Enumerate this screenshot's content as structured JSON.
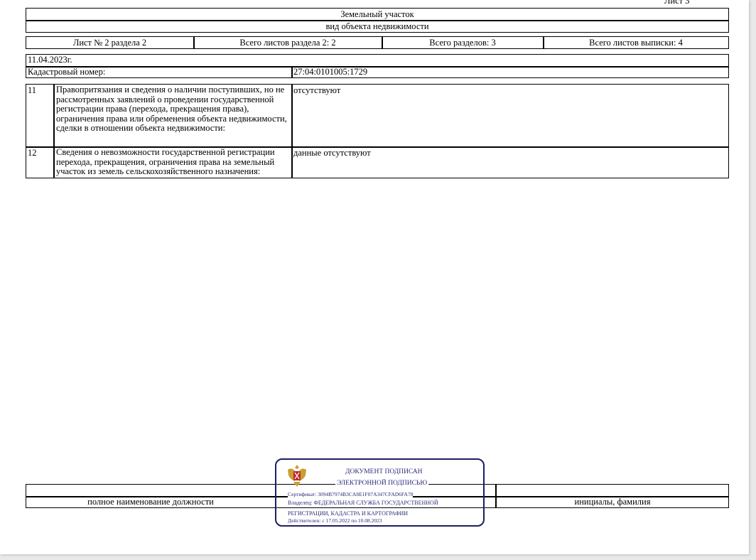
{
  "sheet_label": "Лист 3",
  "header": {
    "object_type": "Земельный участок",
    "object_type_caption": "вид объекта недвижимости"
  },
  "sheet_info": [
    "Лист № 2 раздела 2",
    "Всего листов раздела 2: 2",
    "Всего разделов: 3",
    "Всего листов выписки: 4"
  ],
  "date": "11.04.2023г.",
  "cadastral": {
    "label": "Кадастровый номер:",
    "value": "27:04:0101005:1729"
  },
  "rows": [
    {
      "num": "11",
      "label": "Правопритязания и сведения о наличии поступивших, но не рассмотренных заявлений о проведении государственной регистрации права (перехода, прекращения права), ограничения права или обременения объекта недвижимости, сделки в отношении объекта недвижимости:",
      "value": "отсутствуют"
    },
    {
      "num": "12",
      "label": "Сведения о невозможности государственной регистрации перехода, прекращения, ограничения права на земельный участок из земель сельскохозяйственного назначения:",
      "value": "данные отсутствуют"
    }
  ],
  "footer": {
    "position_caption": "полное наименование должности",
    "name_caption": "инициалы, фамилия"
  },
  "stamp": {
    "line1": "ДОКУМЕНТ ПОДПИСАН",
    "line2": "ЭЛЕКТРОННОЙ ПОДПИСЬЮ",
    "certificate": "Сертификат: 3094B7974B3CA8E1F07A347CFAD6FA78",
    "owner1": "Владелец: ФЕДЕРАЛЬНАЯ СЛУЖБА ГОСУДАРСТВЕННОЙ",
    "owner2": "РЕГИСТРАЦИИ, КАДАСТРА И КАРТОГРАФИИ",
    "valid": "Действителен: с 17.05.2022 по 10.08.2023",
    "emblem_color": "#c8a030",
    "border_color": "#1c1f5e"
  }
}
